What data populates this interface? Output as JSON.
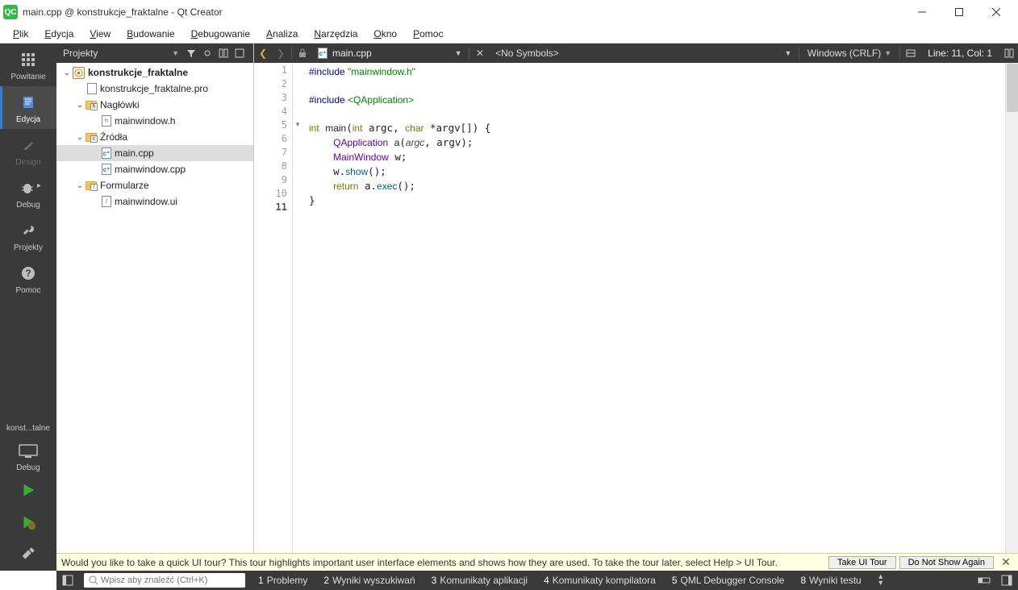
{
  "window": {
    "title": "main.cpp @ konstrukcje_fraktalne - Qt Creator",
    "app_badge": "QC"
  },
  "menu": {
    "items": [
      {
        "label": "Plik",
        "accel": "P"
      },
      {
        "label": "Edycja",
        "accel": "E"
      },
      {
        "label": "View",
        "accel": "V"
      },
      {
        "label": "Budowanie",
        "accel": "B"
      },
      {
        "label": "Debugowanie",
        "accel": "D"
      },
      {
        "label": "Analiza",
        "accel": "A"
      },
      {
        "label": "Narzędzia",
        "accel": "N"
      },
      {
        "label": "Okno",
        "accel": "O"
      },
      {
        "label": "Pomoc",
        "accel": "P"
      }
    ]
  },
  "modebar": {
    "modes": [
      {
        "id": "welcome",
        "label": "Powitanie"
      },
      {
        "id": "edit",
        "label": "Edycja"
      },
      {
        "id": "design",
        "label": "Design"
      },
      {
        "id": "debug",
        "label": "Debug"
      },
      {
        "id": "projects",
        "label": "Projekty"
      },
      {
        "id": "help",
        "label": "Pomoc"
      }
    ],
    "kit_label": "konst...talne",
    "debug_label": "Debug"
  },
  "sidebar": {
    "header": "Projekty",
    "tree": {
      "root_label": "konstrukcje_fraktalne",
      "items": [
        {
          "label": "konstrukcje_fraktalne.pro",
          "type": "pro"
        },
        {
          "label": "Nagłówki",
          "type": "folder",
          "badge": "h",
          "children": [
            {
              "label": "mainwindow.h",
              "type": "h"
            }
          ]
        },
        {
          "label": "Źródła",
          "type": "folder",
          "badge": "c+",
          "children": [
            {
              "label": "main.cpp",
              "type": "cpp",
              "selected": true
            },
            {
              "label": "mainwindow.cpp",
              "type": "cpp"
            }
          ]
        },
        {
          "label": "Formularze",
          "type": "folder",
          "badge": "ui",
          "children": [
            {
              "label": "mainwindow.ui",
              "type": "ui"
            }
          ]
        }
      ]
    }
  },
  "editor": {
    "file_label": "main.cpp",
    "symbols": "<No Symbols>",
    "encoding": "Windows (CRLF)",
    "position": "Line: 11, Col: 1",
    "lines": 11,
    "current_line": 11
  },
  "infobar": {
    "message": "Would you like to take a quick UI tour? This tour highlights important user interface elements and shows how they are used. To take the tour later, select Help > UI Tour.",
    "take_tour": "Take UI Tour",
    "do_not_show": "Do Not Show Again"
  },
  "statusbar": {
    "search_placeholder": "Wpisz aby znaleźć (Ctrl+K)",
    "panes": [
      {
        "num": "1",
        "label": "Problemy"
      },
      {
        "num": "2",
        "label": "Wyniki wyszukiwań"
      },
      {
        "num": "3",
        "label": "Komunikaty aplikacji"
      },
      {
        "num": "4",
        "label": "Komunikaty kompilatora"
      },
      {
        "num": "5",
        "label": "QML Debugger Console"
      },
      {
        "num": "8",
        "label": "Wyniki testu"
      }
    ]
  }
}
